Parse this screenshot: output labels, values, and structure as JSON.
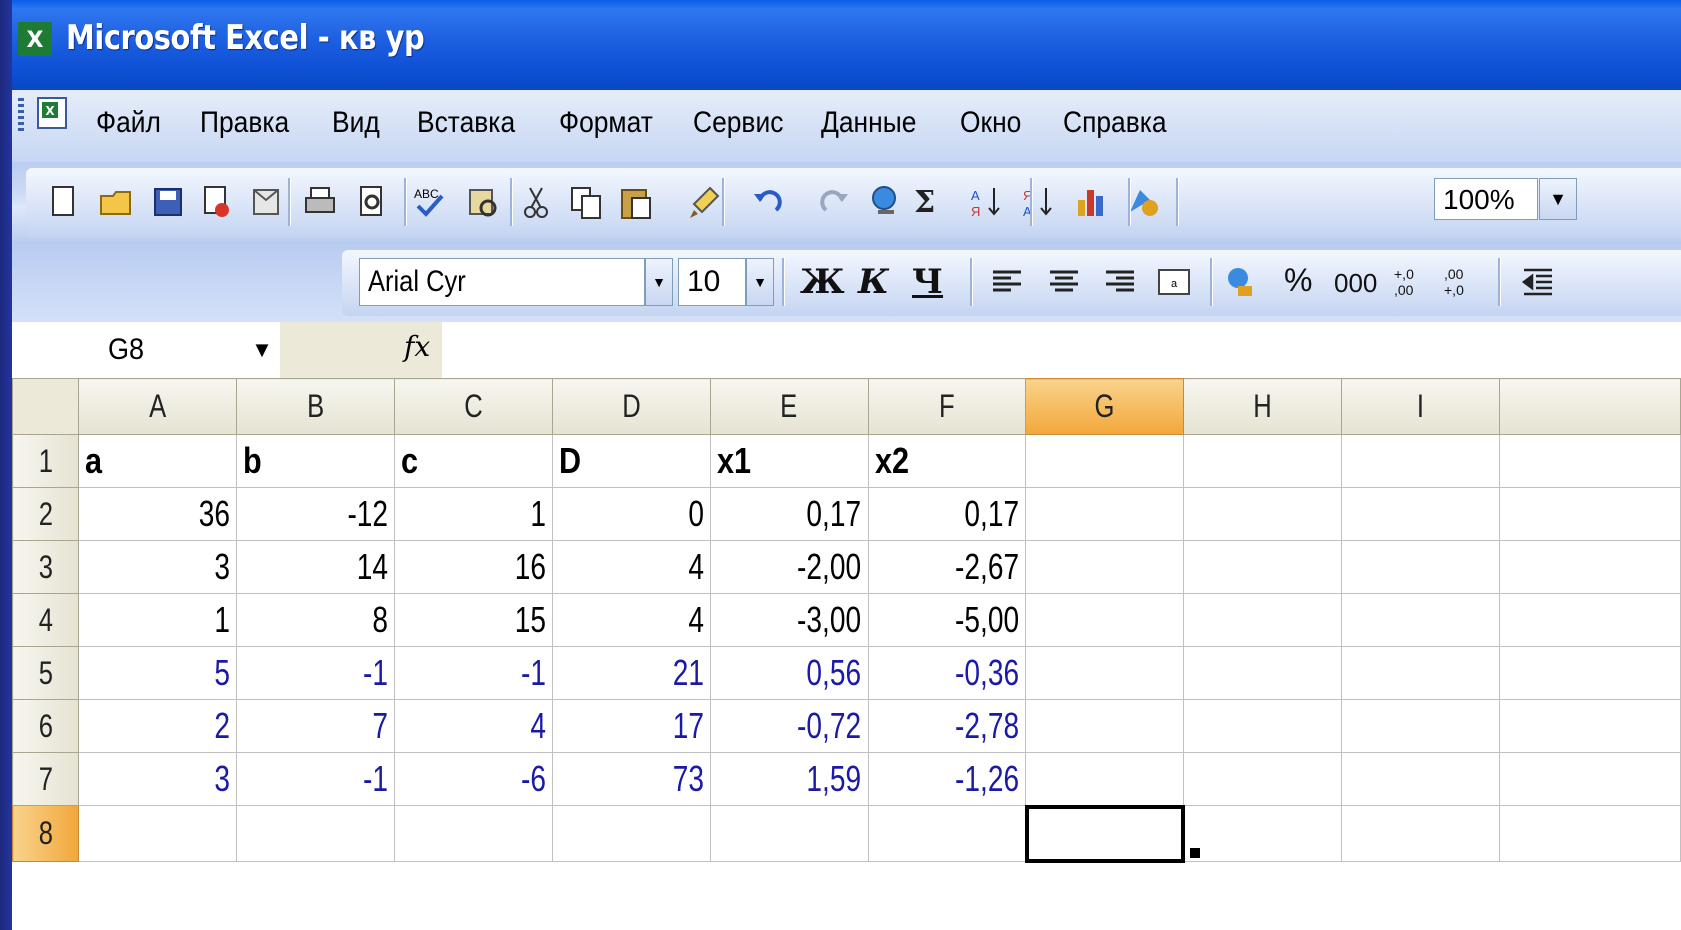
{
  "window": {
    "title": "Microsoft Excel - кв ур"
  },
  "menu": {
    "items": [
      "Файл",
      "Правка",
      "Вид",
      "Вставка",
      "Формат",
      "Сервис",
      "Данные",
      "Окно",
      "Справка"
    ]
  },
  "toolbar": {
    "standard_icons": [
      "new-icon",
      "open-icon",
      "save-icon",
      "permission-icon",
      "email-icon",
      "print-icon",
      "print-preview-icon",
      "spelling-icon",
      "research-icon",
      "cut-icon",
      "copy-icon",
      "paste-icon",
      "format-painter-icon",
      "undo-icon",
      "redo-icon",
      "hyperlink-icon",
      "autosum-icon",
      "sort-ascending-icon",
      "sort-descending-icon",
      "chart-wizard-icon",
      "drawing-icon"
    ],
    "zoom": "100%",
    "font_name": "Arial Cyr",
    "font_size": "10",
    "bold_label": "Ж",
    "italic_label": "К",
    "underline_label": "Ч",
    "percent_label": "%",
    "thousands_label": "000",
    "increase_decimal_label": "+,0 ,00",
    "decrease_decimal_label": ",00 +,0"
  },
  "formula_bar": {
    "name_box": "G8",
    "fx": "fx",
    "formula": ""
  },
  "sheet": {
    "active_cell": "G8",
    "columns": [
      "A",
      "B",
      "C",
      "D",
      "E",
      "F",
      "G",
      "H",
      "I"
    ],
    "rows": [
      {
        "n": "1",
        "cells": [
          "a",
          "b",
          "c",
          "D",
          "x1",
          "x2",
          "",
          "",
          ""
        ]
      },
      {
        "n": "2",
        "cells": [
          "36",
          "-12",
          "1",
          "0",
          "0,17",
          "0,17",
          "",
          "",
          ""
        ]
      },
      {
        "n": "3",
        "cells": [
          "3",
          "14",
          "16",
          "4",
          "-2,00",
          "-2,67",
          "",
          "",
          ""
        ]
      },
      {
        "n": "4",
        "cells": [
          "1",
          "8",
          "15",
          "4",
          "-3,00",
          "-5,00",
          "",
          "",
          ""
        ]
      },
      {
        "n": "5",
        "cells": [
          "5",
          "-1",
          "-1",
          "21",
          "0,56",
          "-0,36",
          "",
          "",
          ""
        ]
      },
      {
        "n": "6",
        "cells": [
          "2",
          "7",
          "4",
          "17",
          "-0,72",
          "-2,78",
          "",
          "",
          ""
        ]
      },
      {
        "n": "7",
        "cells": [
          "3",
          "-1",
          "-6",
          "73",
          "1,59",
          "-1,26",
          "",
          "",
          ""
        ]
      },
      {
        "n": "8",
        "cells": [
          "",
          "",
          "",
          "",
          "",
          "",
          "",
          "",
          ""
        ]
      }
    ],
    "colors": {
      "blue_text": "#1a1aa6",
      "active_header": "#f2a73a"
    }
  }
}
